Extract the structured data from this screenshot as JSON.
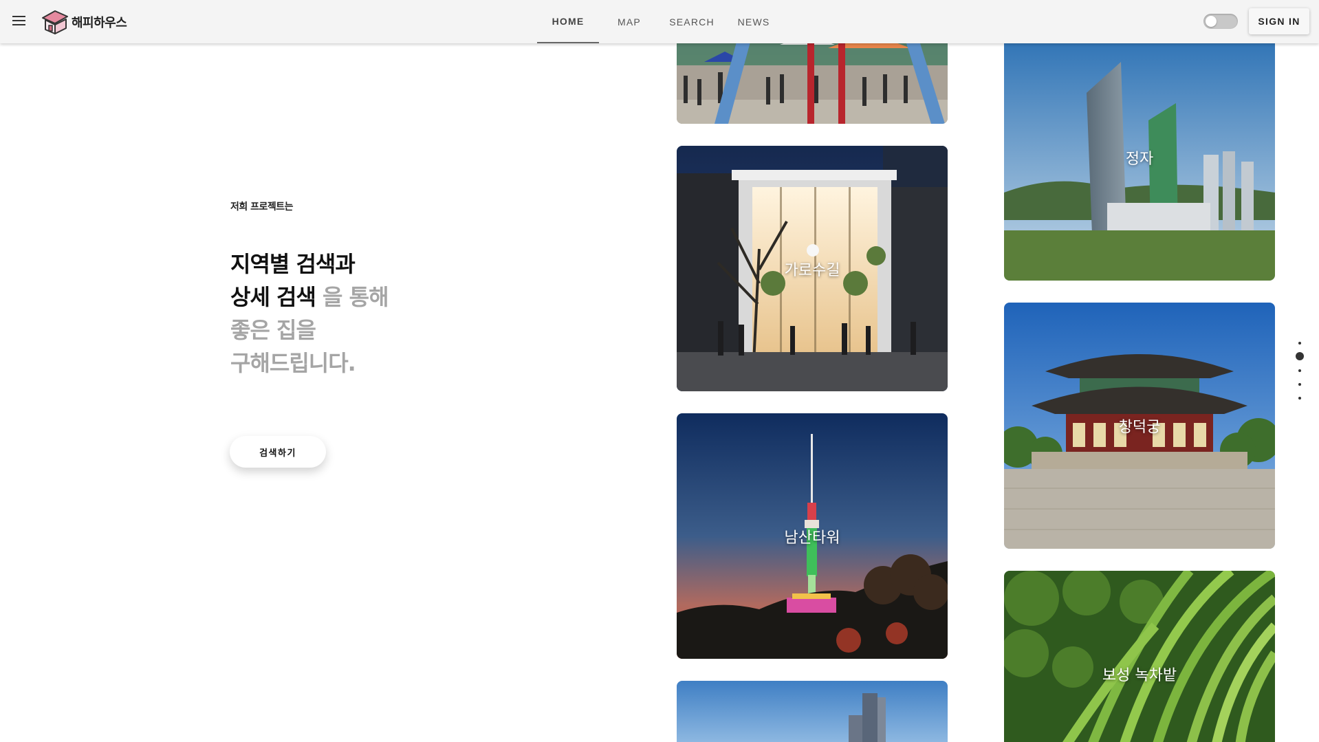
{
  "header": {
    "logo_text": "해피하우스",
    "nav": [
      {
        "label": "HOME",
        "active": true
      },
      {
        "label": "MAP",
        "active": false
      },
      {
        "label": "SEARCH",
        "active": false
      },
      {
        "label": "NEWS",
        "active": false
      }
    ],
    "signin_label": "SIGN IN"
  },
  "hero": {
    "eyebrow": "저희 프로젝트는",
    "line1": "지역별 검색과",
    "line2_dark": "상세 검색",
    "line2_grey": " 을 통해",
    "line3": "좋은 집을",
    "line4": "구해드립니다.",
    "cta_label": "검색하기"
  },
  "cards": [
    {
      "label": ""
    },
    {
      "label": "가로수길"
    },
    {
      "label": "남산타워"
    },
    {
      "label": ""
    },
    {
      "label": "정자"
    },
    {
      "label": "창덕궁"
    },
    {
      "label": "보성 녹차밭"
    }
  ],
  "pagination": {
    "count": 5,
    "active_index": 1
  },
  "colors": {
    "header_bg": "#f4f4f4",
    "grey_text": "#a5a5a5"
  }
}
